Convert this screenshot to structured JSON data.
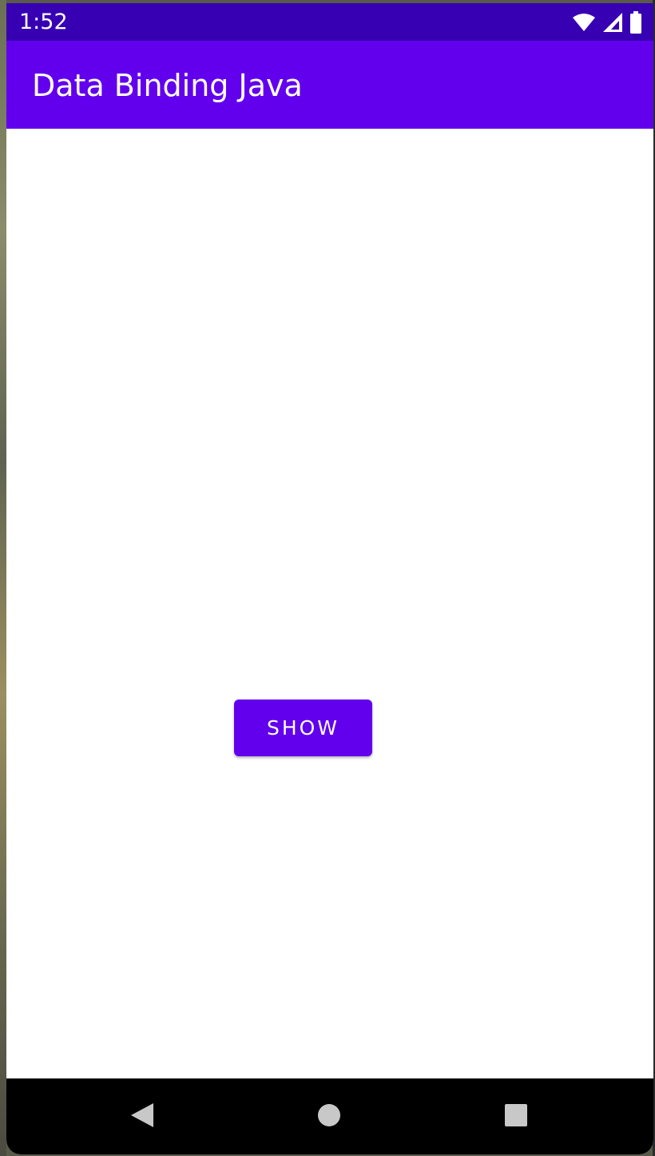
{
  "status_bar": {
    "time": "1:52",
    "icons": [
      "wifi-icon",
      "cellular-signal-icon",
      "battery-icon"
    ],
    "color": "#3700b3"
  },
  "app_bar": {
    "title": "Data Binding Java",
    "color": "#6200ee"
  },
  "main": {
    "show_button_label": "SHOW"
  },
  "nav_bar": {
    "buttons": [
      "back-icon",
      "home-icon",
      "recents-icon"
    ]
  }
}
